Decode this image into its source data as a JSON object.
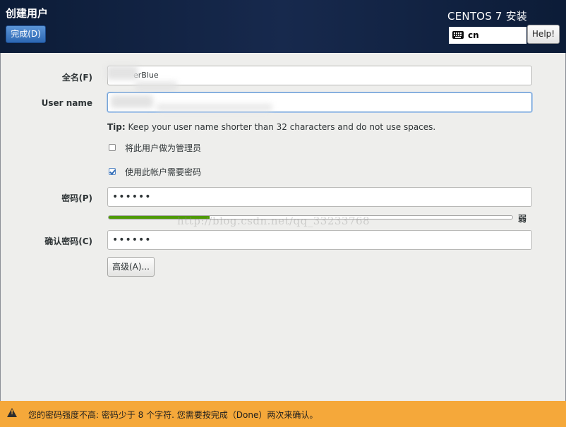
{
  "header": {
    "title": "创建用户",
    "done_label": "完成(D)",
    "product": "CENTOS 7 安装",
    "keyboard_layout": "cn",
    "help_label": "Help!"
  },
  "form": {
    "fullname_label": "全名(F)",
    "fullname_value": "erBlue",
    "username_label": "User name",
    "username_value": "",
    "tip_prefix": "Tip:",
    "tip_text": " Keep your user name shorter than 32 characters and do not use spaces.",
    "admin_checkbox_label": "将此用户做为管理员",
    "admin_checked": false,
    "require_password_label": "使用此帐户需要密码",
    "require_password_checked": true,
    "password_label": "密码(P)",
    "password_value": "••••••",
    "strength": 0.25,
    "strength_label": "弱",
    "confirm_label": "确认密码(C)",
    "confirm_value": "••••••",
    "advanced_label": "高级(A)..."
  },
  "watermark": "http://blog.csdn.net/qq_33233768",
  "warning": {
    "text": "您的密码强度不高: 密码少于 8 个字符. 您需要按完成（Done）两次来确认。"
  },
  "colors": {
    "header_bg": "#17294d",
    "accent": "#2d68b4",
    "warning_bg": "#f5a83a",
    "strength_fill": "#4e9a06"
  }
}
